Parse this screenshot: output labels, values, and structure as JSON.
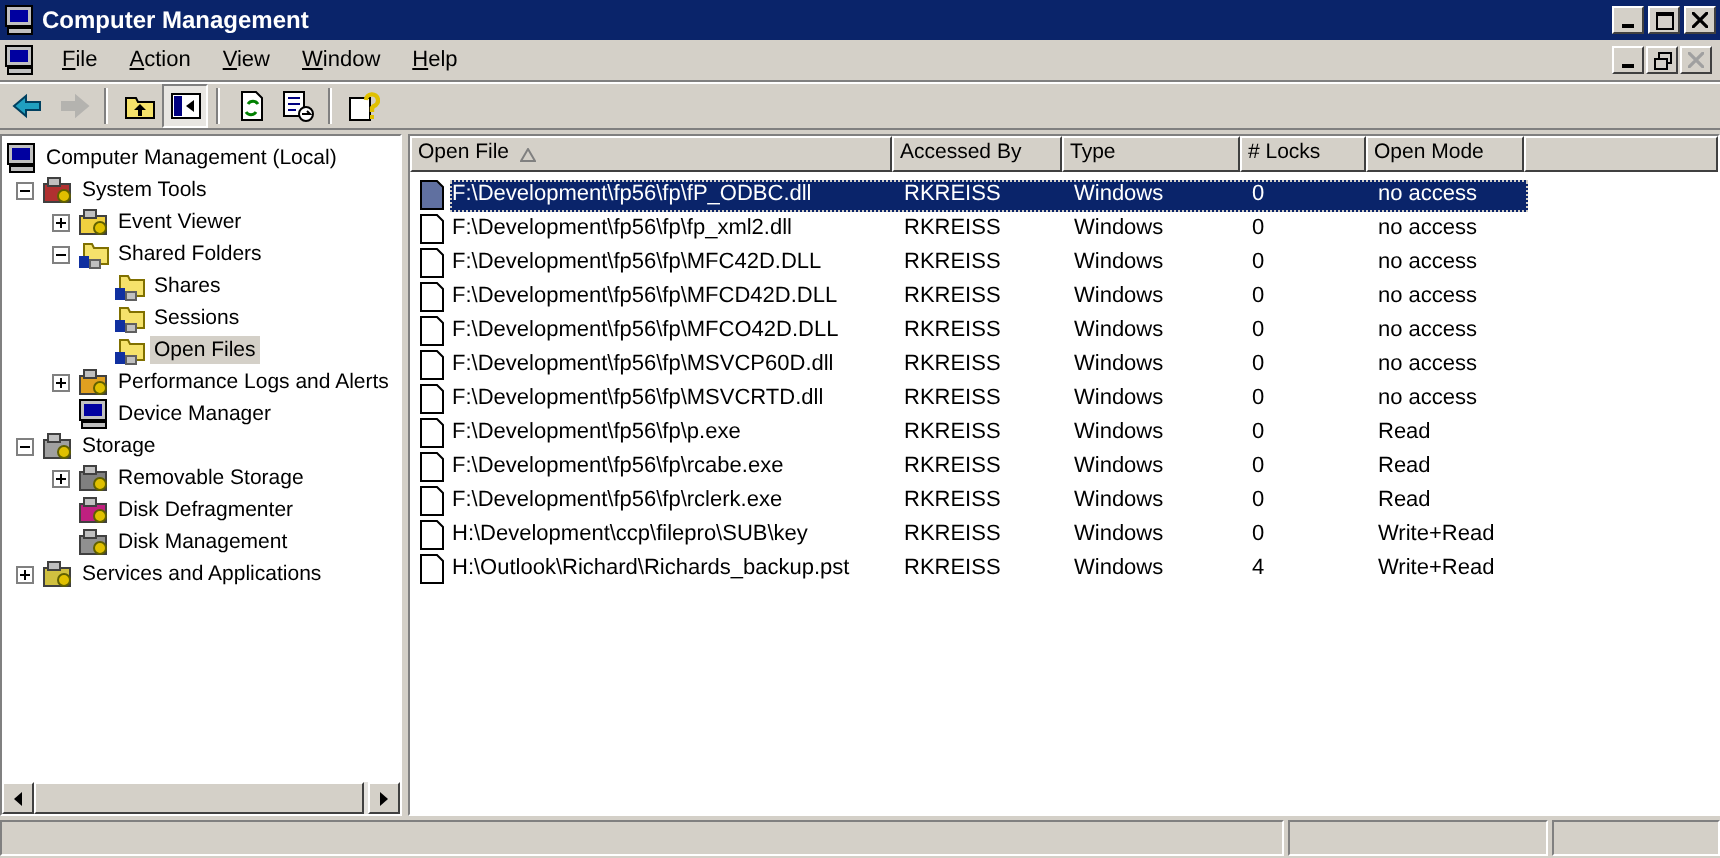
{
  "window": {
    "title": "Computer Management"
  },
  "menu": [
    {
      "label": "File"
    },
    {
      "label": "Action"
    },
    {
      "label": "View"
    },
    {
      "label": "Window"
    },
    {
      "label": "Help"
    }
  ],
  "toolbar": [
    {
      "disabled": false,
      "pressed": false
    },
    {
      "disabled": true,
      "pressed": false
    },
    {
      "disabled": false,
      "pressed": false
    },
    {
      "disabled": false,
      "pressed": true
    },
    {
      "disabled": false,
      "pressed": false
    },
    {
      "disabled": false,
      "pressed": false
    },
    {
      "disabled": false,
      "pressed": false
    }
  ],
  "tree": [
    {
      "label": "Computer Management (Local)",
      "selected": false,
      "children": [
        {
          "label": "System Tools",
          "selected": false,
          "expanded": true,
          "children": [
            {
              "label": "Event Viewer",
              "selected": false,
              "expanded": false
            },
            {
              "label": "Shared Folders",
              "selected": false,
              "expanded": true,
              "children": [
                {
                  "label": "Shares",
                  "selected": false
                },
                {
                  "label": "Sessions",
                  "selected": false
                },
                {
                  "label": "Open Files",
                  "selected": true
                }
              ]
            },
            {
              "label": "Performance Logs and Alerts",
              "selected": false,
              "expanded": false
            },
            {
              "label": "Device Manager",
              "selected": false
            }
          ]
        },
        {
          "label": "Storage",
          "selected": false,
          "expanded": true,
          "children": [
            {
              "label": "Removable Storage",
              "selected": false,
              "expanded": false
            },
            {
              "label": "Disk Defragmenter",
              "selected": false
            },
            {
              "label": "Disk Management",
              "selected": false
            }
          ]
        },
        {
          "label": "Services and Applications",
          "selected": false,
          "expanded": false
        }
      ]
    }
  ],
  "table": {
    "columns": [
      {
        "label": "Open File",
        "sorted": true
      },
      {
        "label": "Accessed By",
        "sorted": false
      },
      {
        "label": "Type",
        "sorted": false
      },
      {
        "label": "# Locks",
        "sorted": false
      },
      {
        "label": "Open Mode",
        "sorted": false
      }
    ],
    "rows": [
      {
        "selected": true,
        "cells": [
          "F:\\Development\\fp56\\fp\\fP_ODBC.dll",
          "RKREISS",
          "Windows",
          "0",
          "no access"
        ]
      },
      {
        "selected": false,
        "cells": [
          "F:\\Development\\fp56\\fp\\fp_xml2.dll",
          "RKREISS",
          "Windows",
          "0",
          "no access"
        ]
      },
      {
        "selected": false,
        "cells": [
          "F:\\Development\\fp56\\fp\\MFC42D.DLL",
          "RKREISS",
          "Windows",
          "0",
          "no access"
        ]
      },
      {
        "selected": false,
        "cells": [
          "F:\\Development\\fp56\\fp\\MFCD42D.DLL",
          "RKREISS",
          "Windows",
          "0",
          "no access"
        ]
      },
      {
        "selected": false,
        "cells": [
          "F:\\Development\\fp56\\fp\\MFCO42D.DLL",
          "RKREISS",
          "Windows",
          "0",
          "no access"
        ]
      },
      {
        "selected": false,
        "cells": [
          "F:\\Development\\fp56\\fp\\MSVCP60D.dll",
          "RKREISS",
          "Windows",
          "0",
          "no access"
        ]
      },
      {
        "selected": false,
        "cells": [
          "F:\\Development\\fp56\\fp\\MSVCRTD.dll",
          "RKREISS",
          "Windows",
          "0",
          "no access"
        ]
      },
      {
        "selected": false,
        "cells": [
          "F:\\Development\\fp56\\fp\\p.exe",
          "RKREISS",
          "Windows",
          "0",
          "Read"
        ]
      },
      {
        "selected": false,
        "cells": [
          "F:\\Development\\fp56\\fp\\rcabe.exe",
          "RKREISS",
          "Windows",
          "0",
          "Read"
        ]
      },
      {
        "selected": false,
        "cells": [
          "F:\\Development\\fp56\\fp\\rclerk.exe",
          "RKREISS",
          "Windows",
          "0",
          "Read"
        ]
      },
      {
        "selected": false,
        "cells": [
          "H:\\Development\\ccp\\filepro\\SUB\\key",
          "RKREISS",
          "Windows",
          "0",
          "Write+Read"
        ]
      },
      {
        "selected": false,
        "cells": [
          "H:\\Outlook\\Richard\\Richards_backup.pst",
          "RKREISS",
          "Windows",
          "4",
          "Write+Read"
        ]
      }
    ]
  }
}
